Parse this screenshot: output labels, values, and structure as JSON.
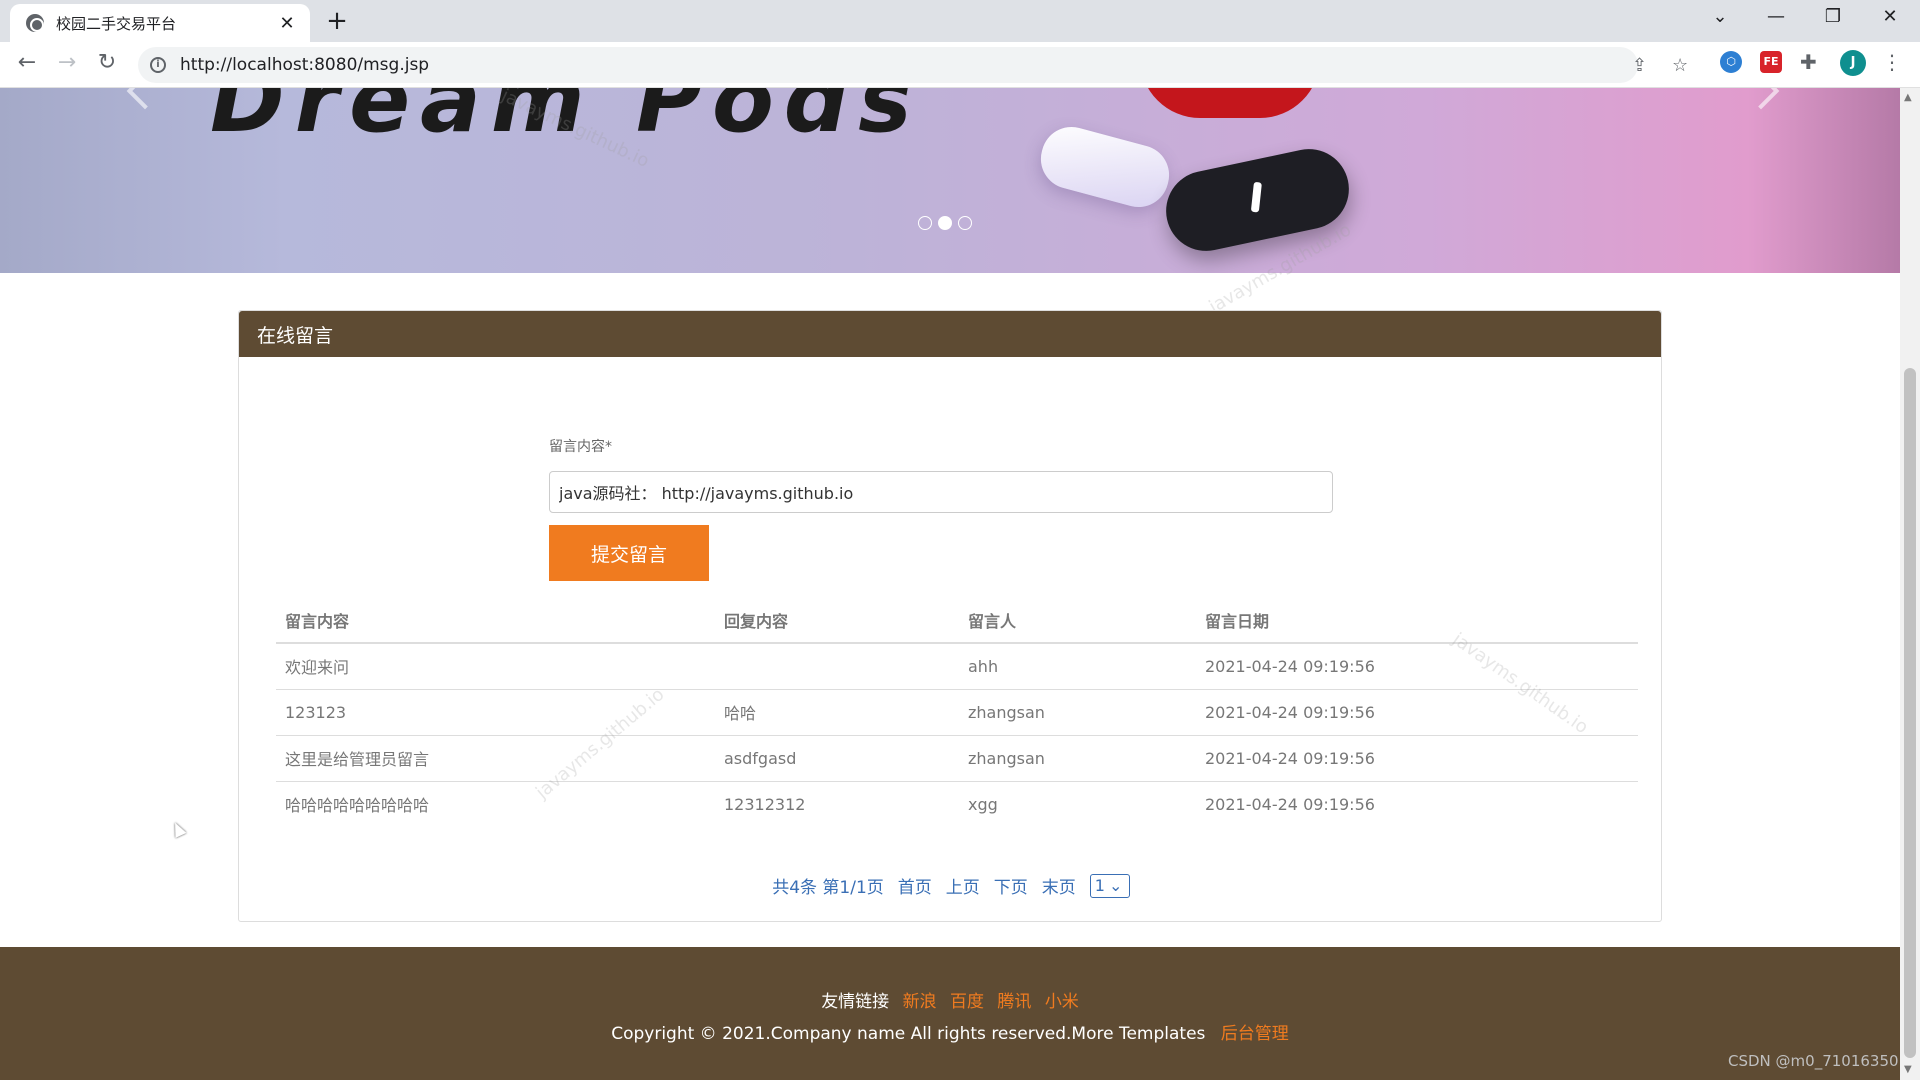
{
  "browser": {
    "tab_title": "校园二手交易平台",
    "tab_close": "✕",
    "new_tab": "+",
    "url": "http://localhost:8080/msg.jsp",
    "avatar_letter": "J"
  },
  "banner": {
    "text": "Dream Pods"
  },
  "panel": {
    "title": "在线留言",
    "form": {
      "label": "留言内容*",
      "input_value": "java源码社： http://javayms.github.io",
      "submit_label": "提交留言"
    },
    "table": {
      "headers": [
        "留言内容",
        "回复内容",
        "留言人",
        "留言日期"
      ],
      "rows": [
        [
          "欢迎来问",
          "",
          "ahh",
          "2021-04-24 09:19:56"
        ],
        [
          "123123",
          "哈哈",
          "zhangsan",
          "2021-04-24 09:19:56"
        ],
        [
          "这里是给管理员留言",
          "asdfgasd",
          "zhangsan",
          "2021-04-24 09:19:56"
        ],
        [
          "哈哈哈哈哈哈哈哈哈",
          "12312312",
          "xgg",
          "2021-04-24 09:19:56"
        ]
      ]
    },
    "pager": {
      "info": "共4条 第1/1页",
      "first": "首页",
      "prev": "上页",
      "next": "下页",
      "last": "末页",
      "page_select": "1"
    }
  },
  "footer": {
    "links_label": "友情链接",
    "links": [
      "新浪",
      "百度",
      "腾讯",
      "小米"
    ],
    "copyright": "Copyright © 2021.Company name All rights reserved.More Templates",
    "admin_link": "后台管理"
  },
  "overlay": {
    "watermark": "javayms.github.io",
    "csdn": "CSDN @m0_71016350"
  },
  "colors": {
    "brown": "#5e4b33",
    "orange": "#f07b1f",
    "link_blue": "#3a6fb5"
  }
}
